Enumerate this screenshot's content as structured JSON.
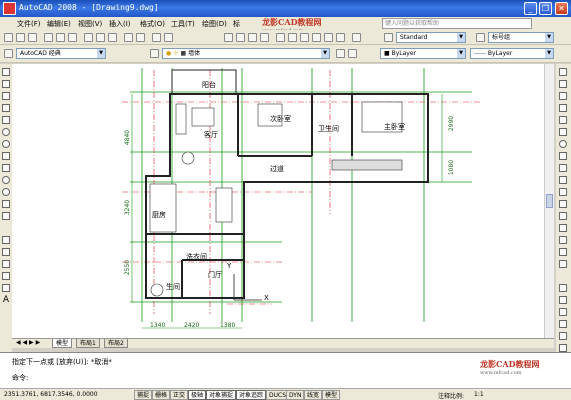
{
  "window": {
    "title": "AutoCAD 2008 - [Drawing9.dwg]",
    "minimize": "_",
    "restore": "❐",
    "close": "✕"
  },
  "menubar": {
    "items": [
      "文件(F)",
      "编辑(E)",
      "视图(V)",
      "插入(I)",
      "格式(O)",
      "工具(T)",
      "绘图(D)",
      "标"
    ],
    "help_search_placeholder": "键入问题以获取帮助",
    "watermark": "龙影CAD教程网",
    "watermark_url": "www.mfcad.com"
  },
  "toolbar": {
    "workspace": "AutoCAD 经典",
    "layer": "墙体",
    "text_style": "Standard",
    "dim_style": "标号组",
    "color": "ByLayer",
    "linetype": "ByLayer"
  },
  "drawing": {
    "rooms": {
      "balcony": "阳台",
      "living": "客厅",
      "secondary_bedroom": "次卧室",
      "bathroom": "卫生间",
      "master_bedroom": "主卧室",
      "corridor": "过道",
      "kitchen": "厨房",
      "laundry": "洗衣间",
      "entry": "门厅",
      "toilet": "生间"
    },
    "dims_bottom": [
      "1340",
      "2420",
      "1380"
    ],
    "dims_left": [
      "4840",
      "3240",
      "2550"
    ],
    "dims_right": [
      "2990",
      "1080"
    ],
    "axis_y": "Y",
    "axis_x": "X"
  },
  "tabs": [
    "模型",
    "布局1",
    "布局2"
  ],
  "command": {
    "line1": "指定下一点或 [放弃(U)]: *取消*",
    "prompt": "命令:"
  },
  "status": {
    "coords": "2351.3761, 6817.3546, 0.0000",
    "buttons": [
      "捕捉",
      "栅格",
      "正交",
      "极轴",
      "对象捕捉",
      "对象追踪",
      "DUCS",
      "DYN",
      "线宽",
      "模型"
    ],
    "scale_label": "注释比例:",
    "scale_value": "1:1"
  }
}
